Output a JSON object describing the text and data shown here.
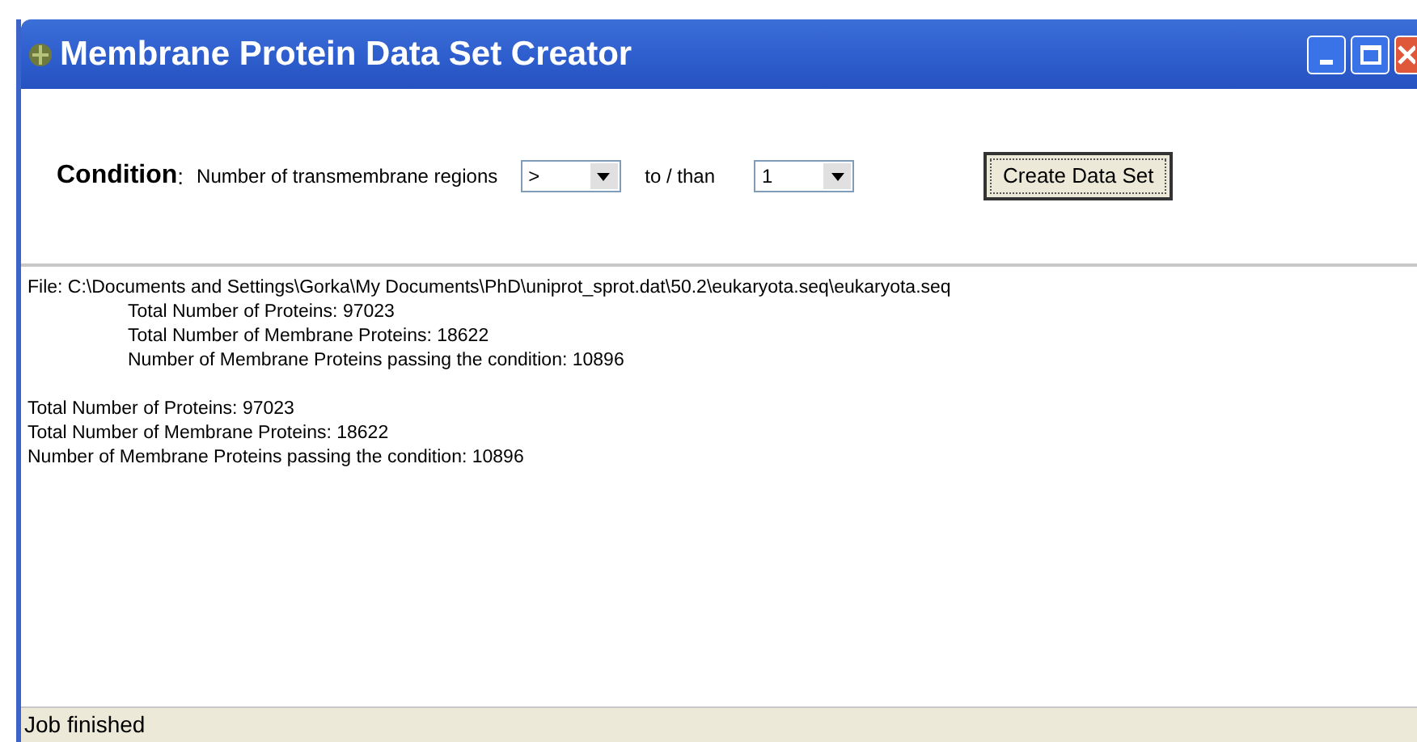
{
  "window": {
    "title": "Membrane Protein Data Set Creator"
  },
  "condition": {
    "label": "Condition",
    "colon": ":",
    "description": "Number of transmembrane regions",
    "operator": {
      "value": ">"
    },
    "connector": "to / than",
    "count": {
      "value": "1"
    },
    "button": "Create Data Set"
  },
  "log": [
    {
      "text": "File: C:\\Documents and Settings\\Gorka\\My Documents\\PhD\\uniprot_sprot.dat\\50.2\\eukaryota.seq\\eukaryota.seq",
      "indented": false
    },
    {
      "text": "Total Number of Proteins: 97023",
      "indented": true
    },
    {
      "text": "Total Number of Membrane Proteins: 18622",
      "indented": true
    },
    {
      "text": "Number of Membrane Proteins passing the condition: 10896",
      "indented": true
    },
    {
      "kind": "blank"
    },
    {
      "text": "Total Number of Proteins: 97023",
      "indented": false
    },
    {
      "text": "Total Number of Membrane Proteins: 18622",
      "indented": false
    },
    {
      "text": "Number of Membrane Proteins passing the condition: 10896",
      "indented": false
    }
  ],
  "status_bar": "Job finished"
}
